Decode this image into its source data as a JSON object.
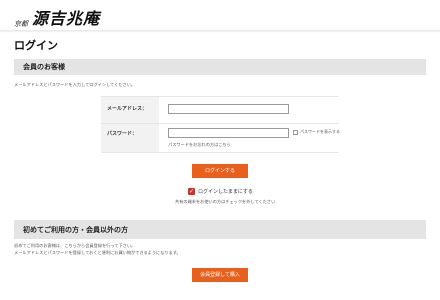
{
  "header": {
    "brand_sub": "京都",
    "brand_name": "源吉兆庵"
  },
  "page_title": "ログイン",
  "member_section": {
    "heading": "会員のお客様",
    "intro": "メールアドレスとパスワードを入力してログインしてください。",
    "email_label": "メールアドレス：",
    "email_value": "",
    "password_label": "パスワード：",
    "password_value": "",
    "show_password_label": "パスワードを表示する",
    "forgot_password": "パスワードをお忘れの方はこちら",
    "login_button": "ログインする",
    "stay_logged_in": "ログインしたままにする",
    "stay_note": "共有の端末をお使いの方はチェックを外してください"
  },
  "guest_section": {
    "heading": "初めてご利用の方・会員以外の方",
    "line1": "初めてご利用のお客様は、こちらから会員登録を行って下さい。",
    "line2": "メールアドレスとパスワードを登録しておくと便利にお買い物ができるようになります。",
    "register_button": "会員登録して購入"
  },
  "colors": {
    "accent": "#e8601c",
    "checkbox": "#c0392b"
  }
}
